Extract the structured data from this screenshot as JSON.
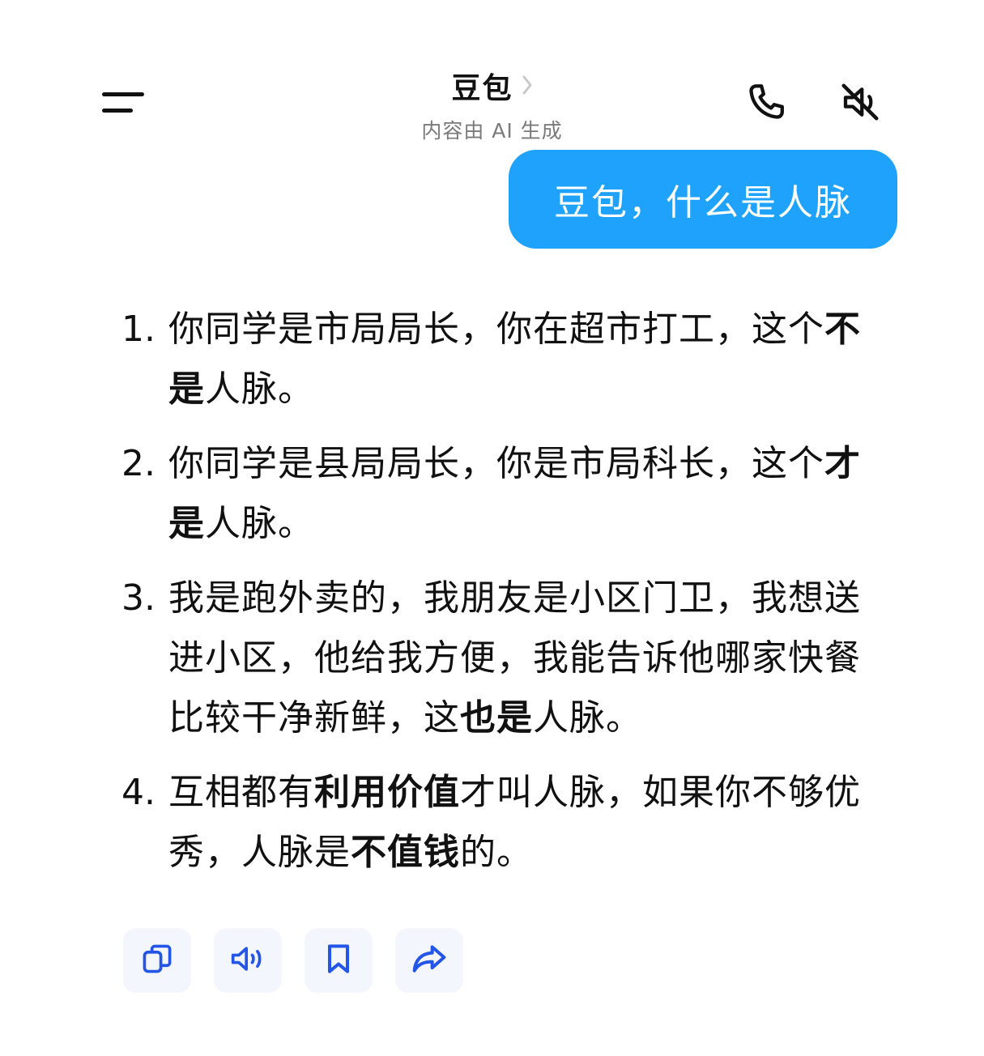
{
  "header": {
    "title": "豆包",
    "subtitle": "内容由 AI 生成",
    "icons": {
      "menu": "menu-icon",
      "chevron": "chevron-right-icon",
      "call": "phone-icon",
      "mute": "speaker-muted-icon"
    }
  },
  "user_message": {
    "text": "豆包，什么是人脉",
    "bubble_color": "#1fa2fb"
  },
  "reply": {
    "items": [
      {
        "num": "1.",
        "seg0": "你同学是市局局长，你在超市打工，这个",
        "seg1": "不是",
        "seg2": "人脉。"
      },
      {
        "num": "2.",
        "seg0": "你同学是县局局长，你是市局科长，这个",
        "seg1": "才是",
        "seg2": "人脉。"
      },
      {
        "num": "3.",
        "seg0": "我是跑外卖的，我朋友是小区门卫，我想送进小区，他给我方便，我能告诉他哪家快餐比较干净新鲜，这",
        "seg1": "也是",
        "seg2": "人脉。"
      },
      {
        "num": "4.",
        "seg0": "互相都有",
        "seg1": "利用价值",
        "seg2": "才叫人脉，如果你不够优秀，人脉是",
        "seg3": "不值钱",
        "seg4": "的。"
      }
    ]
  },
  "actions": {
    "icons": [
      "copy-icon",
      "speaker-icon",
      "bookmark-icon",
      "share-icon"
    ],
    "accent_color": "#2355e6"
  }
}
